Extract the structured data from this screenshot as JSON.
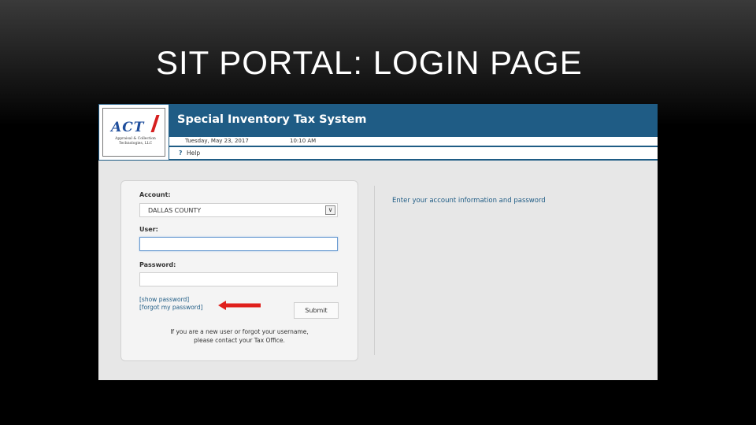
{
  "slide": {
    "title": "SIT PORTAL: LOGIN PAGE"
  },
  "logo": {
    "name": "ACT",
    "subtitle": "Appraisal & Collection Technologies, LLC"
  },
  "header": {
    "system_title": "Special Inventory Tax System",
    "date": "Tuesday, May 23, 2017",
    "time": "10:10 AM",
    "help_icon": "?",
    "help_label": "Help"
  },
  "form": {
    "account_label": "Account:",
    "account_value": "DALLAS COUNTY",
    "user_label": "User:",
    "user_value": "",
    "password_label": "Password:",
    "password_value": "",
    "show_password_link": "[show password]",
    "forgot_password_link": "[forgot my password]",
    "submit_label": "Submit",
    "note_line1": "If you are a new user or forgot your username,",
    "note_line2": "please contact your Tax Office."
  },
  "instruction": "Enter your account information and password",
  "colors": {
    "header_blue": "#1f5c85",
    "arrow_red": "#e0201c",
    "slide_bg": "#000000"
  },
  "icons": {
    "dropdown": "chevron-down-icon",
    "annotation": "red-arrow-icon"
  }
}
